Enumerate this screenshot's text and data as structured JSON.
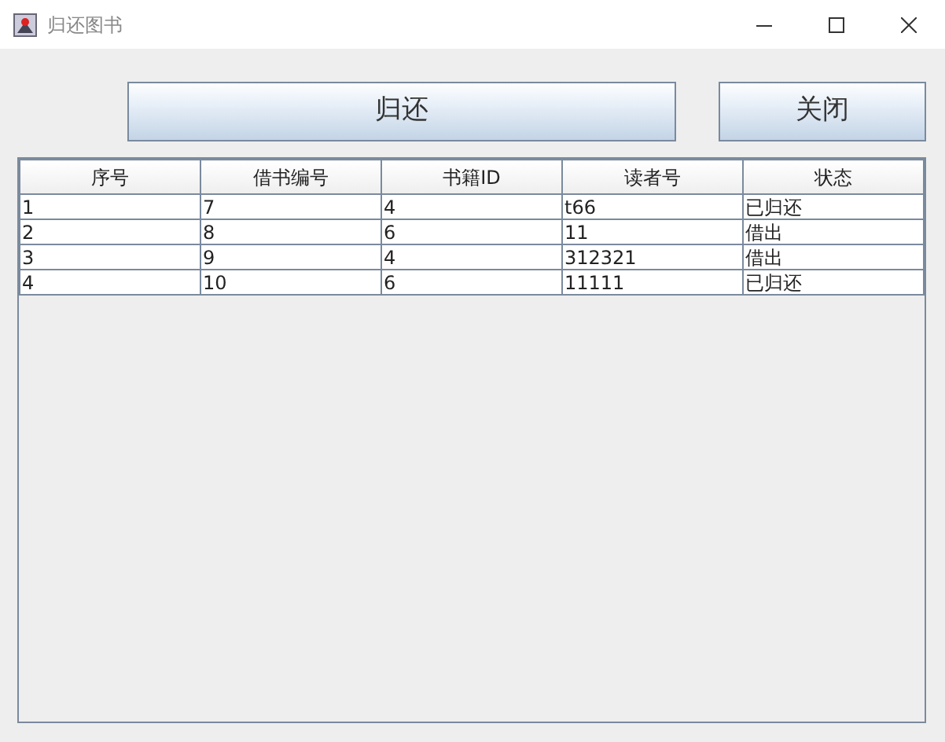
{
  "window": {
    "title": "归还图书"
  },
  "buttons": [
    "归还",
    "关闭"
  ],
  "table": {
    "columns": [
      "序号",
      "借书编号",
      "书籍ID",
      "读者号",
      "状态"
    ],
    "rows": [
      [
        "1",
        "7",
        "4",
        "t66",
        "已归还"
      ],
      [
        "2",
        "8",
        "6",
        "11",
        "借出"
      ],
      [
        "3",
        "9",
        "4",
        "312321",
        "借出"
      ],
      [
        "4",
        "10",
        "6",
        "11111",
        "已归还"
      ]
    ]
  }
}
